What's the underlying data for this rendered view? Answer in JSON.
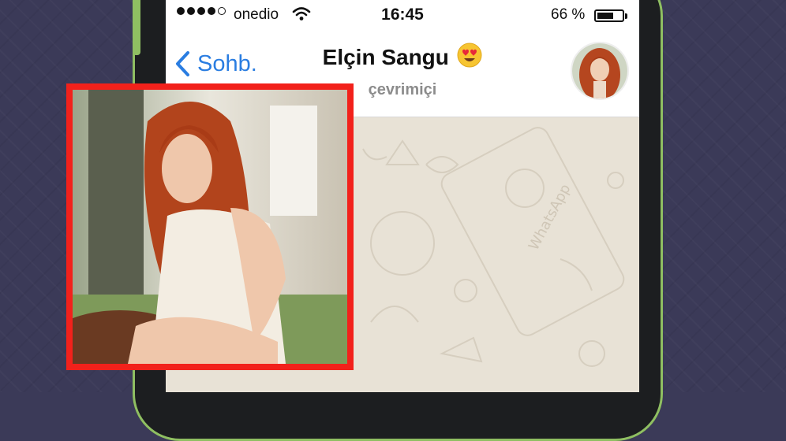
{
  "status_bar": {
    "signal_filled": 4,
    "signal_total": 5,
    "carrier": "onedio",
    "time": "16:45",
    "battery_percent": "66 %",
    "battery_level": 0.66
  },
  "navbar": {
    "back_label": "Sohb.",
    "contact_name": "Elçin Sangu",
    "presence": "çevrimiçi",
    "name_emoji_icon": "heart-eyes-emoji-icon"
  },
  "chat": {
    "wallpaper_watermark": "WhatsApp"
  },
  "colors": {
    "background": "#3b3a58",
    "phone_accent": "#8fbf62",
    "ios_blue": "#2a7de1",
    "highlight_frame": "#f2211b",
    "chat_wallpaper": "#e8e2d6"
  }
}
